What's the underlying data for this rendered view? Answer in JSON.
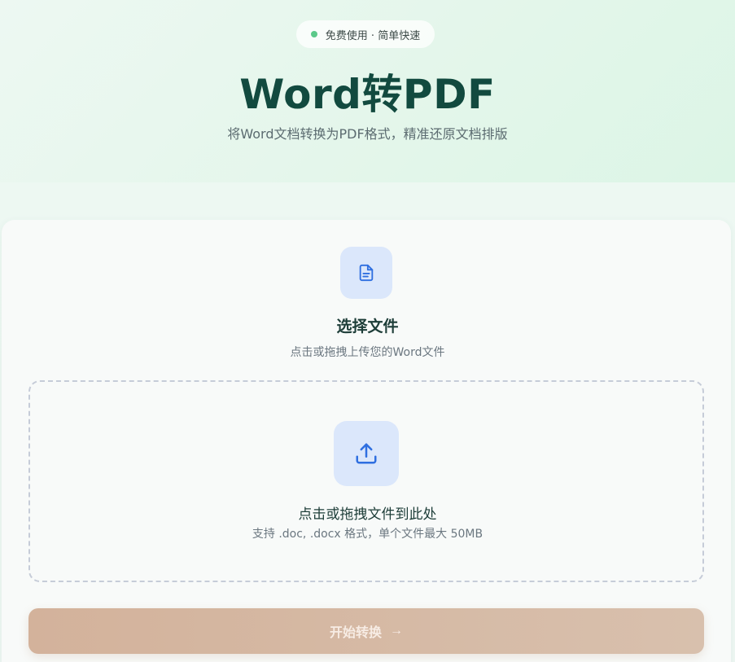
{
  "hero": {
    "badge_text": "免费使用 · 简单快速",
    "title": "Word转PDF",
    "subtitle": "将Word文档转换为PDF格式，精准还原文档排版"
  },
  "upload": {
    "file_icon": "document-icon",
    "select_title": "选择文件",
    "select_subtitle": "点击或拖拽上传您的Word文件",
    "drop_icon": "upload-icon",
    "drop_title": "点击或拖拽文件到此处",
    "drop_subtitle": "支持 .doc, .docx 格式，单个文件最大 50MB"
  },
  "actions": {
    "convert_label": "开始转换",
    "convert_arrow": "→"
  },
  "colors": {
    "accent_green": "#5cc98a",
    "title_color": "#124a3f",
    "icon_blue": "#2f6fe0",
    "button_disabled": "#d3b29b"
  }
}
